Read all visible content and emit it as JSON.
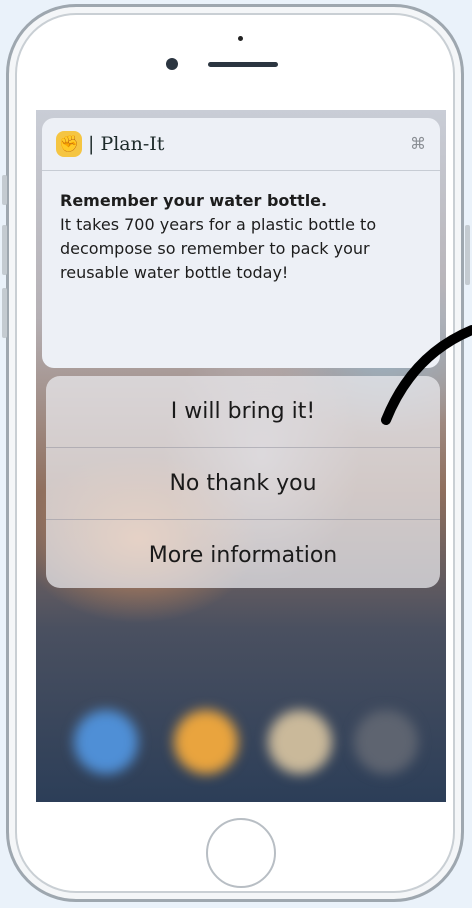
{
  "notification": {
    "app_icon_emoji": "✊",
    "app_name": "| Plan-It",
    "close_glyph": "⌘",
    "title": "Remember your water bottle.",
    "message": "It takes 700 years for a plastic bottle to decompose so remember to pack your reusable water bottle today!"
  },
  "actions": [
    {
      "label": "I will bring it!"
    },
    {
      "label": "No thank you"
    },
    {
      "label": "More information"
    }
  ],
  "colors": {
    "accent_app_icon": "#f5c542",
    "arrow": "#000000"
  }
}
